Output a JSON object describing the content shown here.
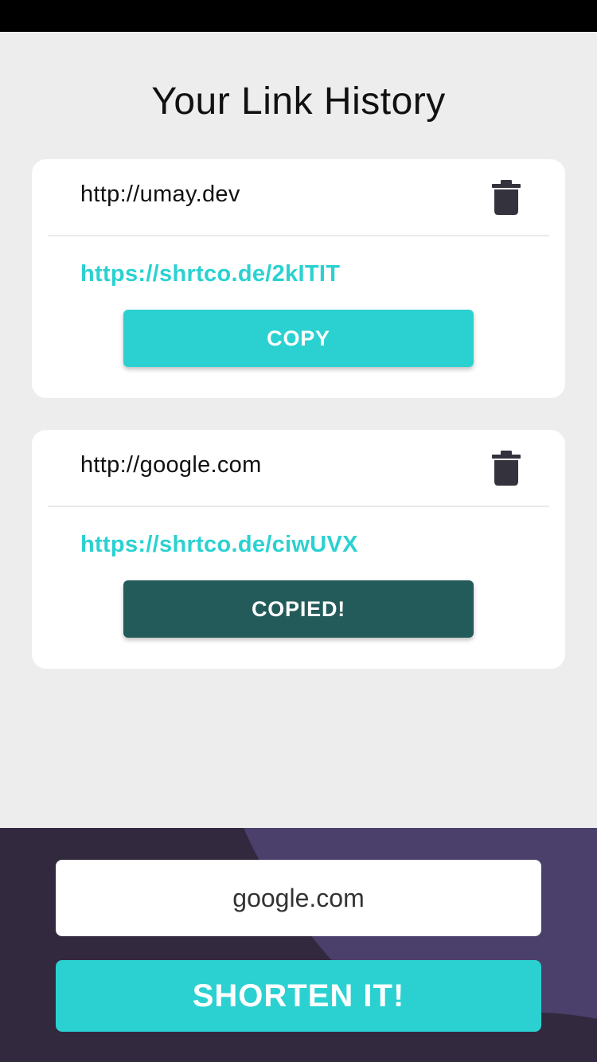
{
  "header": {
    "title": "Your Link History"
  },
  "history": [
    {
      "original": "http://umay.dev",
      "short": "https://shrtco.de/2kITIT",
      "button_label": "COPY",
      "state": "default"
    },
    {
      "original": "http://google.com",
      "short": "https://shrtco.de/ciwUVX",
      "button_label": "COPIED!",
      "state": "copied"
    }
  ],
  "form": {
    "input_value": "google.com",
    "submit_label": "SHORTEN IT!"
  },
  "colors": {
    "accent": "#2bd1d1",
    "copied": "#235b5a",
    "panel": "#33293f",
    "panel_shape": "#4b3f6b",
    "icon": "#34323d"
  },
  "icons": {
    "delete": "trash-icon"
  }
}
